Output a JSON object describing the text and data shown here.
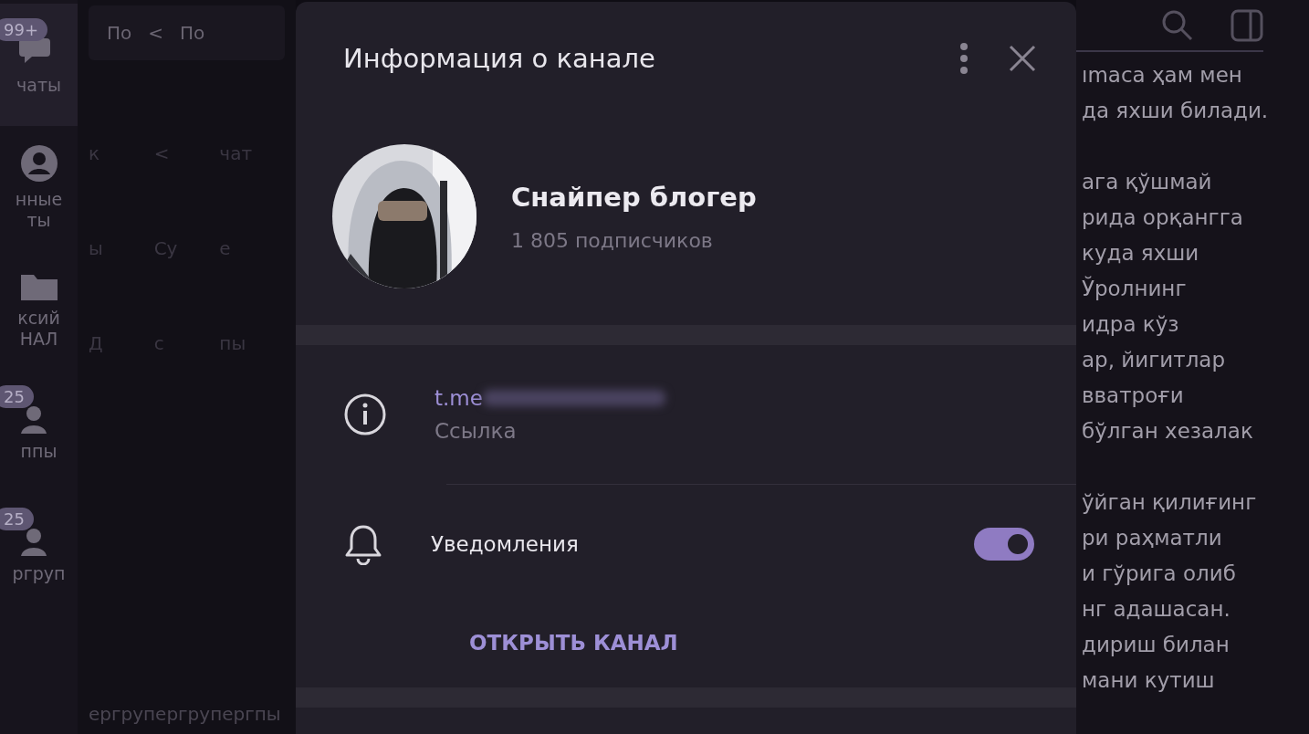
{
  "folders": [
    {
      "label": "чаты",
      "badge": "99+",
      "selected": true,
      "kind": "chat"
    },
    {
      "label": "нные\nты",
      "selected": false,
      "kind": "person"
    },
    {
      "label": "ксий\nНАЛ",
      "selected": false,
      "kind": "folder"
    },
    {
      "label": "ппы",
      "badge": "25",
      "selected": false,
      "kind": "group"
    },
    {
      "label": "ргруп",
      "badge": "25",
      "selected": false,
      "kind": "group"
    }
  ],
  "chat_list": {
    "search_fragments": [
      "По",
      "<",
      "По"
    ],
    "fragments": [
      "к",
      "<",
      "чат",
      "ы",
      "Су",
      "е",
      "Д",
      "с",
      "пы"
    ],
    "bottom_fragment": "ергрупергрупергпы"
  },
  "dialog": {
    "title": "Информация о канале",
    "channel": {
      "name": "Снайпер блогер",
      "subscribers": "1 805 подписчиков"
    },
    "link": {
      "value": "t.me",
      "label": "Ссылка"
    },
    "notifications": {
      "label": "Уведомления",
      "on": true
    },
    "action": "ОТКРЫТЬ КАНАЛ"
  },
  "message_paragraphs": [
    [
      "ımаса ҳам мен",
      "да яхши билади."
    ],
    [
      "ага қўшмай",
      "рида орқангга",
      "куда яхши",
      "Ўролнинг",
      "идра кўз",
      "ар, йигитлар",
      "вватроғи",
      "бўлган хезалак"
    ],
    [
      "ўйган қилиғинг",
      "ри раҳматли",
      "и гўрига олиб",
      "нг адашасан.",
      "дириш билан",
      "мани кутиш"
    ]
  ]
}
